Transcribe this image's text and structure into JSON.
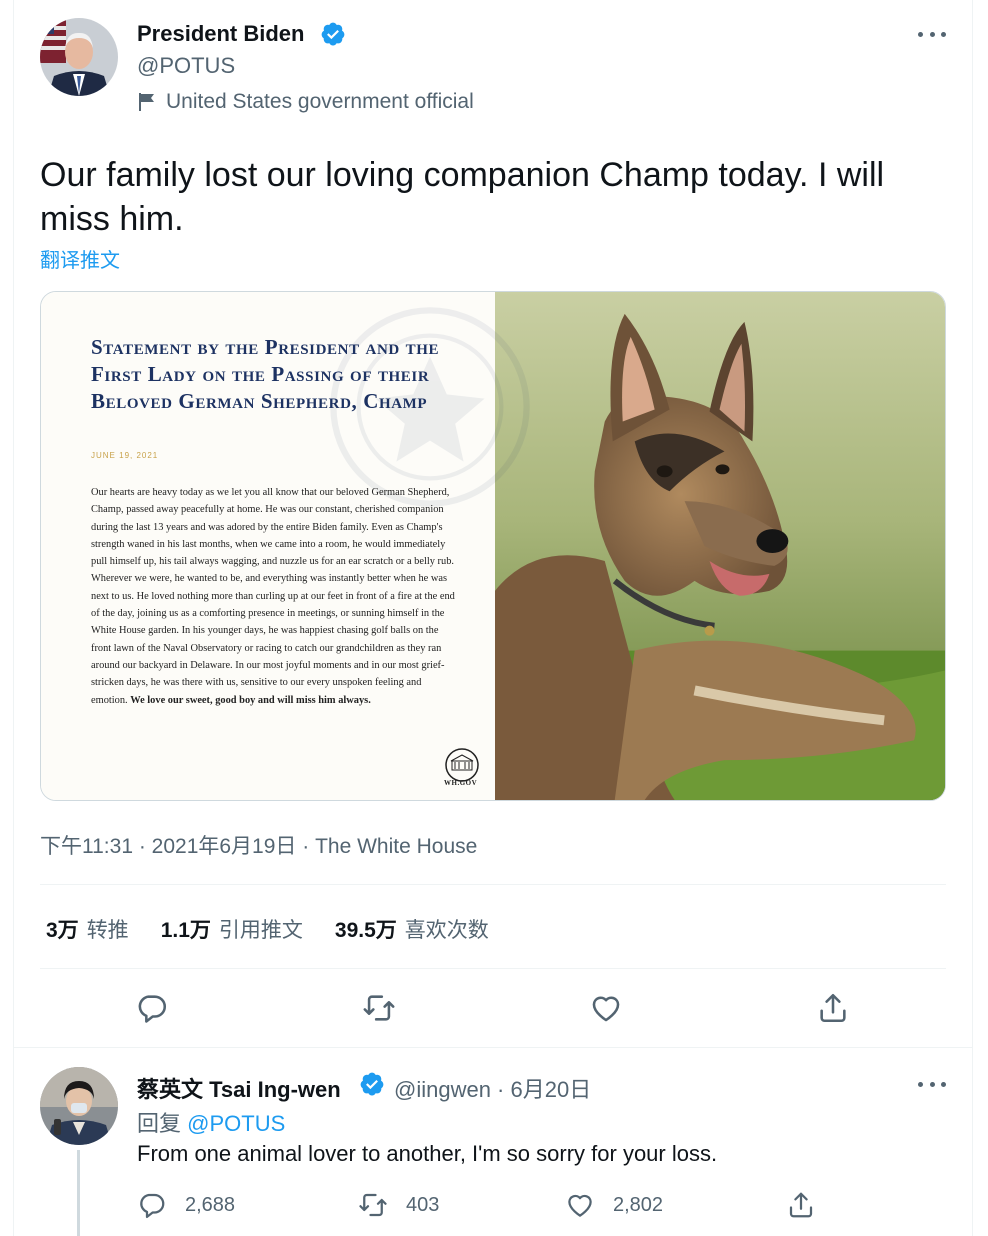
{
  "tweet": {
    "author_name": "President Biden",
    "author_handle": "@POTUS",
    "gov_label": "United States government official",
    "text": "Our family lost our loving companion Champ today. I will miss him.",
    "translate_label": "翻译推文",
    "statement": {
      "title": "Statement by the President and the First Lady on the Passing of their Beloved German Shepherd, Champ",
      "date": "JUNE 19, 2021",
      "body": "Our hearts are heavy today as we let you all know that our beloved German Shepherd, Champ, passed away peacefully at home. He was our constant, cherished companion during the last 13 years and was adored by the entire Biden family. Even as Champ's strength waned in his last months, when we came into a room, he would immediately pull himself up, his tail always wagging, and nuzzle us for an ear scratch or a belly rub. Wherever we were, he wanted to be, and everything was instantly better when he was next to us. He loved nothing more than curling up at our feet in front of a fire at the end of the day, joining us as a comforting presence in meetings, or sunning himself in the White House garden. In his younger days, he was happiest chasing golf balls on the front lawn of the Naval Observatory or racing to catch our grandchildren as they ran around our backyard in Delaware. In our most joyful moments and in our most grief-stricken days, he was there with us, sensitive to our every unspoken feeling and emotion.",
      "body_bold": "We love our sweet, good boy and will miss him always.",
      "seal_caption": "WH.GOV"
    },
    "meta": "下午11:31 · 2021年6月19日 · The White House",
    "stats": [
      {
        "count": "3万",
        "label": "转推"
      },
      {
        "count": "1.1万",
        "label": "引用推文"
      },
      {
        "count": "39.5万",
        "label": "喜欢次数"
      }
    ]
  },
  "reply": {
    "author_name": "蔡英文 Tsai Ing-wen",
    "author_handle_date": "@iingwen · 6月20日",
    "reply_prefix": "回复",
    "reply_target": "@POTUS",
    "text": "From one animal lover to another, I'm so sorry for your loss.",
    "replies": "2,688",
    "retweets": "403",
    "likes": "2,802"
  },
  "colors": {
    "accent": "#1d9bf0",
    "text_primary": "#0f1419",
    "text_secondary": "#536471",
    "statement_title": "#1d3262",
    "statement_date": "#c8a24a"
  },
  "icons": [
    "verified-badge-icon",
    "more-icon",
    "flag-icon",
    "reply-icon",
    "retweet-icon",
    "like-icon",
    "share-icon",
    "white-house-seal-icon"
  ]
}
